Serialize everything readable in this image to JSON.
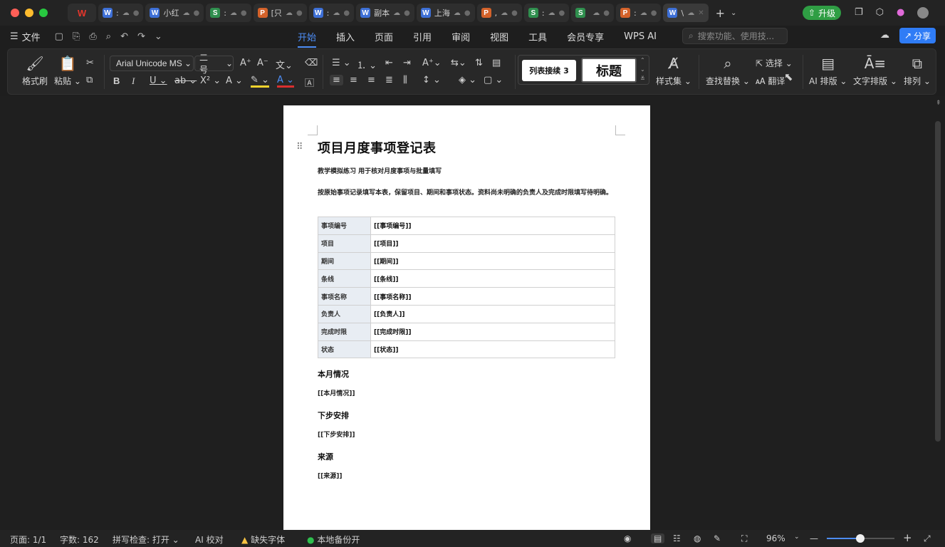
{
  "window": {
    "traffic_colors": [
      "#ff5f57",
      "#febc2e",
      "#28c840"
    ]
  },
  "tabs": [
    {
      "type": "W",
      "color": "#3d6fd6",
      "title": ":",
      "cloud": true
    },
    {
      "type": "W",
      "color": "#3d6fd6",
      "title": "小红",
      "cloud": true
    },
    {
      "type": "S",
      "color": "#2f8f4e",
      "title": ":",
      "cloud": true
    },
    {
      "type": "P",
      "color": "#d4622a",
      "title": "[只",
      "cloud": true
    },
    {
      "type": "W",
      "color": "#3d6fd6",
      "title": ":",
      "cloud": true
    },
    {
      "type": "W",
      "color": "#3d6fd6",
      "title": "副本",
      "cloud": true
    },
    {
      "type": "W",
      "color": "#3d6fd6",
      "title": "上海",
      "cloud": true
    },
    {
      "type": "P",
      "color": "#d4622a",
      "title": ",",
      "cloud": true
    },
    {
      "type": "S",
      "color": "#2f8f4e",
      "title": ":",
      "cloud": true
    },
    {
      "type": "S",
      "color": "#2f8f4e",
      "title": "",
      "cloud": true
    },
    {
      "type": "P",
      "color": "#d4622a",
      "title": ":",
      "cloud": true
    },
    {
      "type": "W",
      "color": "#3d6fd6",
      "title": "\\",
      "cloud": true,
      "active": true
    }
  ],
  "titlebar": {
    "upgrade_label": "升级"
  },
  "menubar": {
    "file_label": "文件",
    "menus": [
      "开始",
      "插入",
      "页面",
      "引用",
      "审阅",
      "视图",
      "工具",
      "会员专享",
      "WPS AI"
    ],
    "active_menu": "开始",
    "search_placeholder": "搜索功能、使用技...",
    "share_label": "分享"
  },
  "ribbon": {
    "format_painter": "格式刷",
    "paste": "粘贴",
    "font_name": "Arial Unicode MS",
    "font_size": "二号",
    "style_list": "列表接续 3",
    "style_title": "标题",
    "style_set": "样式集",
    "find_replace": "查找替换",
    "select": "选择",
    "translate": "翻译",
    "ai_layout": "AI 排版",
    "text_layout": "文字排版",
    "arrange": "排列"
  },
  "document": {
    "title": "项目月度事项登记表",
    "subtitle": "教学模拟练习  用于核对月度事项与批量填写",
    "intro": "按原始事项记录填写本表，保留项目、期间和事项状态。资料尚未明确的负责人及完成时限填写待明确。",
    "table": [
      {
        "key": "事项编号",
        "value": "[[事项编号]]"
      },
      {
        "key": "项目",
        "value": "[[项目]]"
      },
      {
        "key": "期间",
        "value": "[[期间]]"
      },
      {
        "key": "条线",
        "value": "[[条线]]"
      },
      {
        "key": "事项名称",
        "value": "[[事项名称]]"
      },
      {
        "key": "负责人",
        "value": "[[负责人]]"
      },
      {
        "key": "完成时限",
        "value": "[[完成时限]]"
      },
      {
        "key": "状态",
        "value": "[[状态]]"
      }
    ],
    "sections": [
      {
        "heading": "本月情况",
        "value": "[[本月情况]]"
      },
      {
        "heading": "下步安排",
        "value": "[[下步安排]]"
      },
      {
        "heading": "来源",
        "value": "[[来源]]"
      }
    ]
  },
  "statusbar": {
    "page": "页面: 1/1",
    "words": "字数: 162",
    "spell": "拼写检查: 打开",
    "ai_check": "AI 校对",
    "missing_font": "缺失字体",
    "backup": "本地备份开",
    "zoom": "96%",
    "zoom_level": 0.49
  }
}
